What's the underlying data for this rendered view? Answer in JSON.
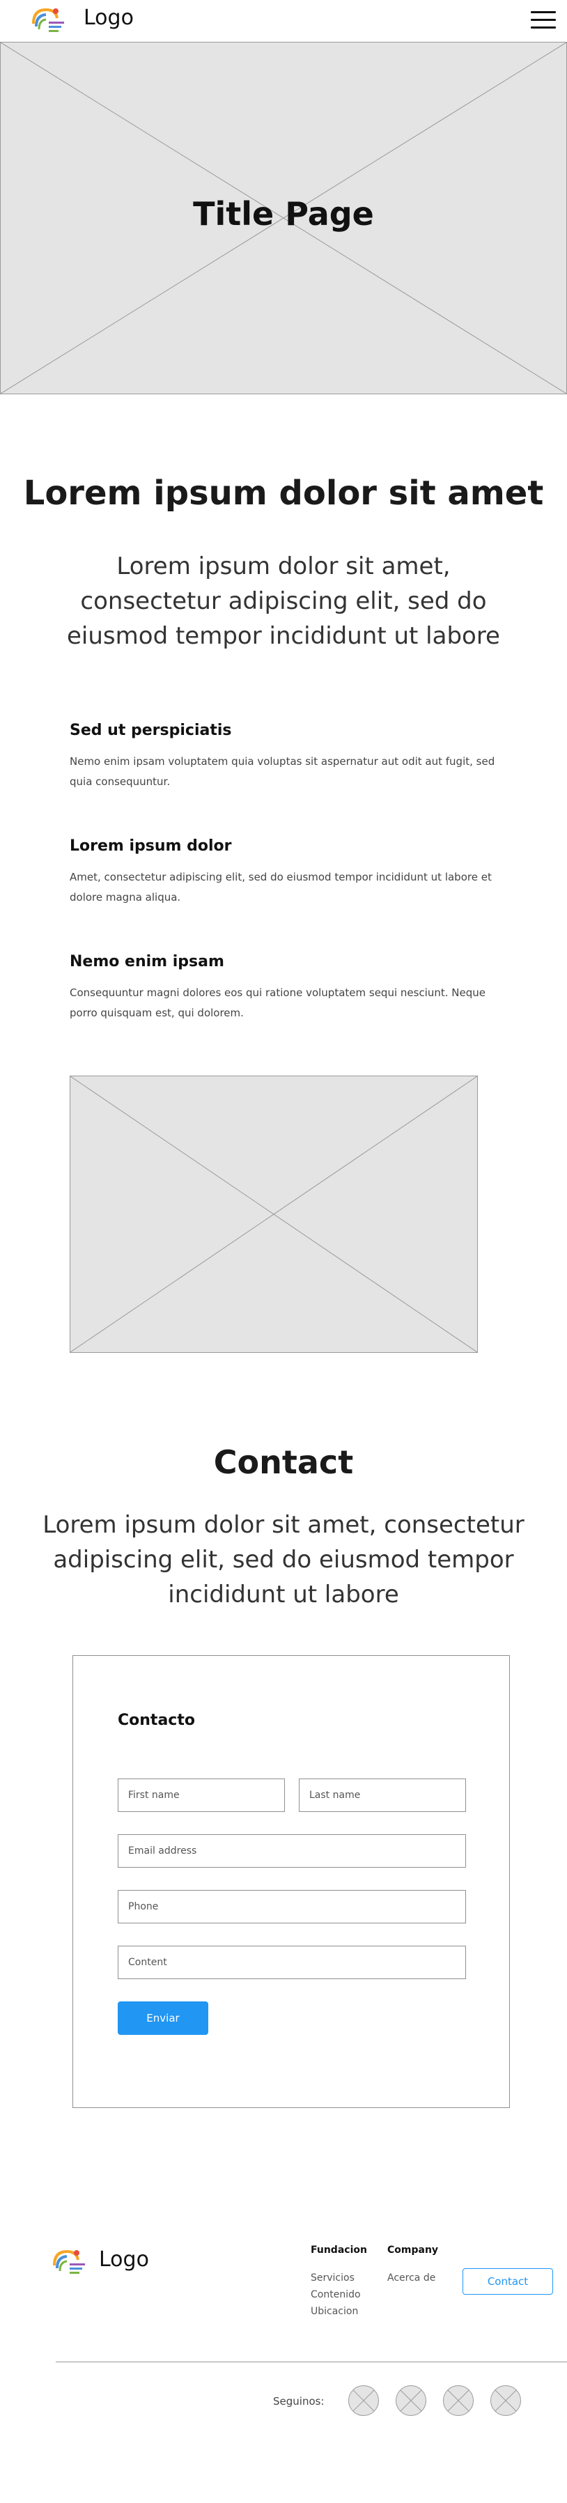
{
  "header": {
    "logo_icon": "fundacion-logo-icon",
    "logo_text": "Logo",
    "menu_icon": "hamburger-menu-icon"
  },
  "hero": {
    "title": "Title Page",
    "image_icon": "image-placeholder-icon"
  },
  "intro": {
    "title": "Lorem ipsum dolor sit amet",
    "subtitle": "Lorem ipsum dolor sit amet, consectetur adipiscing elit, sed do eiusmod tempor incididunt ut labore"
  },
  "features": [
    {
      "title": "Sed ut perspiciatis",
      "text": "Nemo enim ipsam voluptatem quia voluptas sit aspernatur aut odit aut fugit, sed quia consequuntur."
    },
    {
      "title": "Lorem ipsum dolor",
      "text": "Amet, consectetur adipiscing elit, sed do eiusmod tempor incididunt ut labore et dolore magna aliqua."
    },
    {
      "title": "Nemo enim ipsam",
      "text": "Consequuntur magni dolores eos qui ratione voluptatem sequi nesciunt. Neque porro quisquam est, qui dolorem."
    }
  ],
  "contact": {
    "title": "Contact",
    "subtitle": "Lorem ipsum dolor sit amet, consectetur adipiscing elit, sed do eiusmod tempor incididunt ut labore"
  },
  "form": {
    "heading": "Contacto",
    "first_name_placeholder": "First name",
    "last_name_placeholder": "Last name",
    "email_placeholder": "Email address",
    "phone_placeholder": "Phone",
    "content_placeholder": "Content",
    "submit_label": "Enviar"
  },
  "footer": {
    "logo_text": "Logo",
    "columns": [
      {
        "title": "Fundacion",
        "links": [
          "Servicios",
          "Contenido",
          "Ubicacion"
        ]
      },
      {
        "title": "Company",
        "links": [
          "Acerca de"
        ]
      }
    ],
    "contact_button": "Contact",
    "follow_label": "Seguinos:",
    "social_icons": [
      "social-icon-1",
      "social-icon-2",
      "social-icon-3",
      "social-icon-4"
    ]
  },
  "colors": {
    "accent": "#2196f3",
    "placeholder_fill": "#e4e4e4",
    "border": "#8f8f8f",
    "logo_orange": "#f5a623",
    "logo_blue": "#4a90d9",
    "logo_green": "#7cb342",
    "logo_red": "#e74c3c"
  }
}
